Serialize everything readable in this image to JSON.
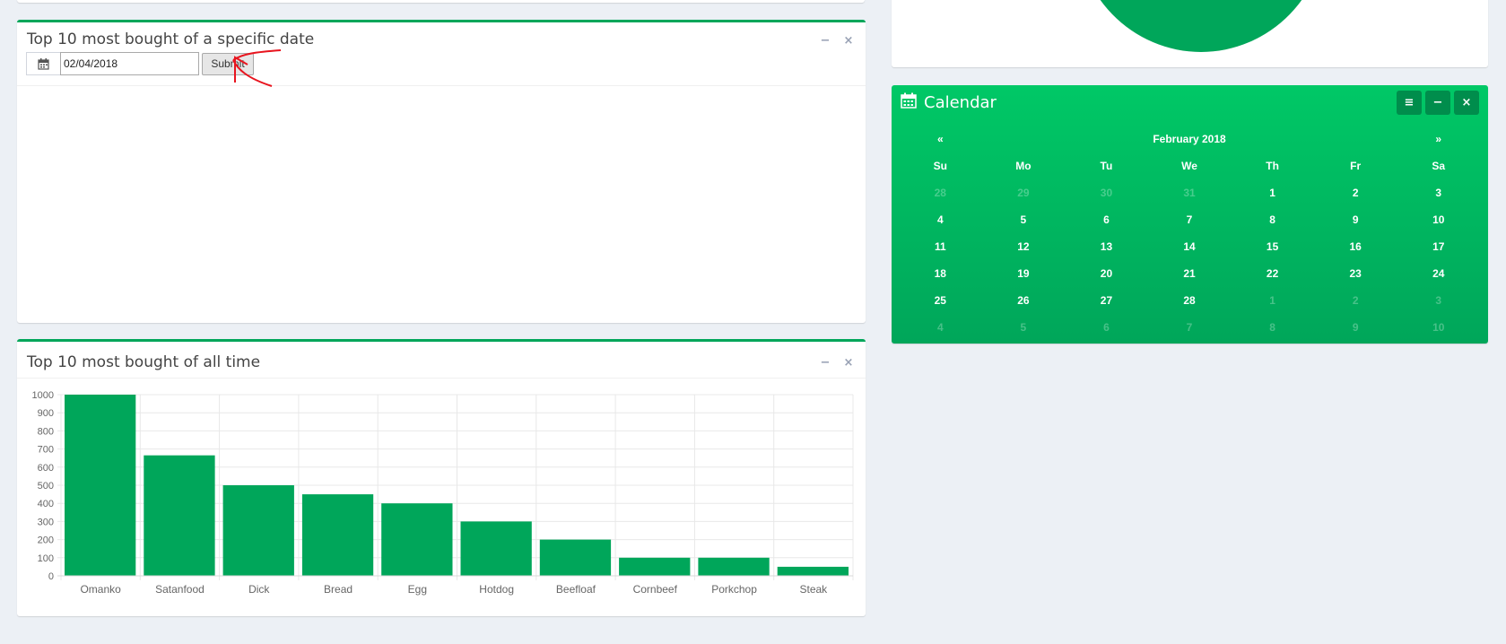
{
  "date_box": {
    "title": "Top 10 most bought of a specific date",
    "date_value": "02/04/2018",
    "submit_label": "Submit",
    "minimize_symbol": "−",
    "close_symbol": "×"
  },
  "chart_box": {
    "title": "Top 10 most bought of all time",
    "minimize_symbol": "−",
    "close_symbol": "×"
  },
  "calendar": {
    "title": "Calendar",
    "month_label": "February 2018",
    "prev_symbol": "«",
    "next_symbol": "»",
    "menu_symbol": "≡",
    "minimize_symbol": "−",
    "close_symbol": "×",
    "weekdays": [
      "Su",
      "Mo",
      "Tu",
      "We",
      "Th",
      "Fr",
      "Sa"
    ],
    "weeks": [
      [
        {
          "d": "28",
          "m": true
        },
        {
          "d": "29",
          "m": true
        },
        {
          "d": "30",
          "m": true
        },
        {
          "d": "31",
          "m": true
        },
        {
          "d": "1"
        },
        {
          "d": "2"
        },
        {
          "d": "3"
        }
      ],
      [
        {
          "d": "4"
        },
        {
          "d": "5"
        },
        {
          "d": "6"
        },
        {
          "d": "7"
        },
        {
          "d": "8"
        },
        {
          "d": "9"
        },
        {
          "d": "10"
        }
      ],
      [
        {
          "d": "11"
        },
        {
          "d": "12"
        },
        {
          "d": "13"
        },
        {
          "d": "14"
        },
        {
          "d": "15"
        },
        {
          "d": "16"
        },
        {
          "d": "17"
        }
      ],
      [
        {
          "d": "18"
        },
        {
          "d": "19"
        },
        {
          "d": "20"
        },
        {
          "d": "21"
        },
        {
          "d": "22"
        },
        {
          "d": "23"
        },
        {
          "d": "24"
        }
      ],
      [
        {
          "d": "25"
        },
        {
          "d": "26"
        },
        {
          "d": "27"
        },
        {
          "d": "28"
        },
        {
          "d": "1",
          "m": true
        },
        {
          "d": "2",
          "m": true
        },
        {
          "d": "3",
          "m": true
        }
      ],
      [
        {
          "d": "4",
          "m": true
        },
        {
          "d": "5",
          "m": true
        },
        {
          "d": "6",
          "m": true
        },
        {
          "d": "7",
          "m": true
        },
        {
          "d": "8",
          "m": true
        },
        {
          "d": "9",
          "m": true
        },
        {
          "d": "10",
          "m": true
        }
      ]
    ]
  },
  "colors": {
    "accent_green": "#00a65a",
    "calendar_top": "#00c866",
    "annotation_red": "#e8141e"
  },
  "chart_data": {
    "type": "bar",
    "categories": [
      "Omanko",
      "Satanfood",
      "Dick",
      "Bread",
      "Egg",
      "Hotdog",
      "Beefloaf",
      "Cornbeef",
      "Porkchop",
      "Steak"
    ],
    "values": [
      1000,
      665,
      500,
      450,
      400,
      300,
      200,
      100,
      100,
      50
    ],
    "yticks": [
      "0",
      "100",
      "200",
      "300",
      "400",
      "500",
      "600",
      "700",
      "800",
      "900",
      "1000"
    ],
    "ylim": [
      0,
      1000
    ],
    "title": "",
    "xlabel": "",
    "ylabel": "",
    "grid": true,
    "legend": "none",
    "bar_color": "#00a65a"
  }
}
